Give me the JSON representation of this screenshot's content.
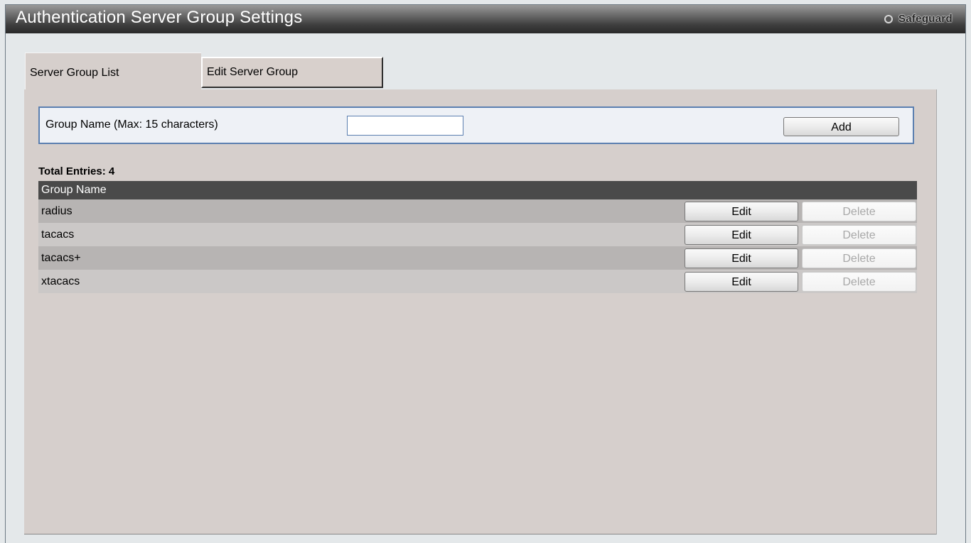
{
  "window": {
    "title": "Authentication Server Group Settings",
    "safeguard_label": "Safeguard"
  },
  "tabs": [
    {
      "label": "Server Group List",
      "active": true
    },
    {
      "label": "Edit Server Group",
      "active": false
    }
  ],
  "form": {
    "group_name_label": "Group Name  (Max: 15 characters)",
    "group_name_value": "",
    "add_label": "Add"
  },
  "table": {
    "total_entries_label": "Total Entries: 4",
    "header": "Group Name",
    "edit_label": "Edit",
    "delete_label": "Delete",
    "rows": [
      {
        "name": "radius"
      },
      {
        "name": "tacacs"
      },
      {
        "name": "tacacs+"
      },
      {
        "name": "xtacacs"
      }
    ]
  },
  "icons": {
    "safeguard": "status-circle-icon"
  }
}
